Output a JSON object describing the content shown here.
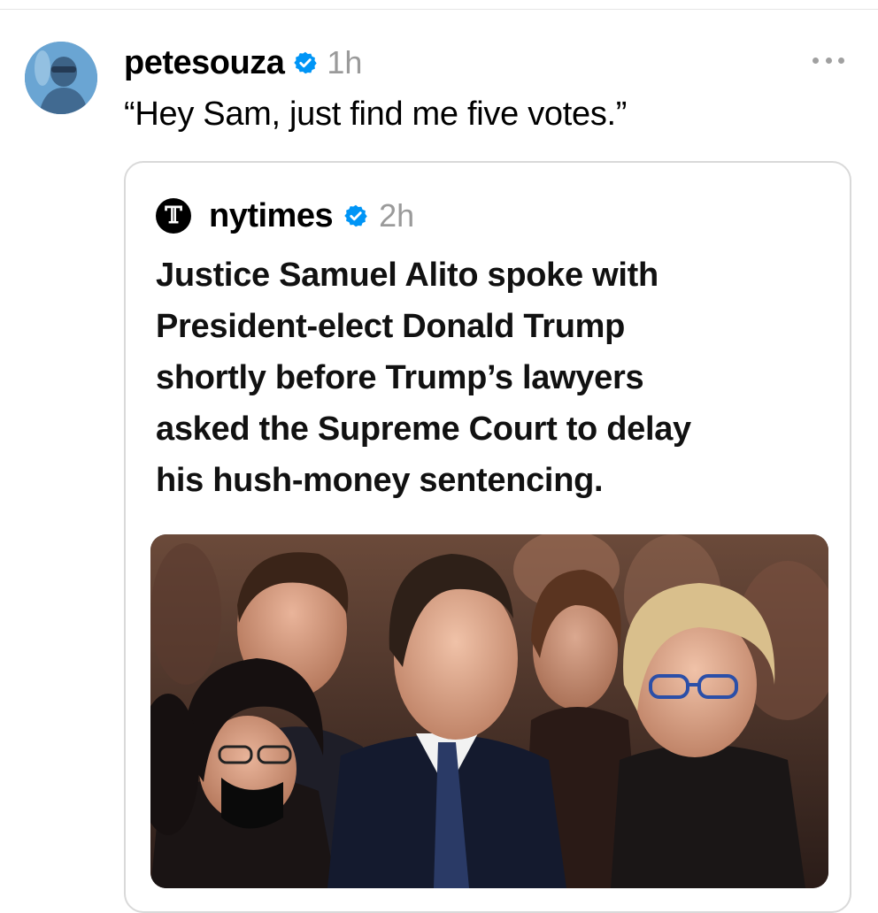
{
  "post": {
    "username": "petesouza",
    "time": "1h",
    "caption": "“Hey Sam, just find me five votes.”",
    "avatar_icon": "profile-photo-avatar",
    "verified_icon": "verified-badge-icon",
    "more_icon": "more-options-icon"
  },
  "quoted": {
    "username": "nytimes",
    "time": "2h",
    "logo_glyph": "𝕋",
    "logo_icon": "nyt-logo-icon",
    "text_lines": [
      "Justice Samuel Alito spoke with",
      "President-elect Donald Trump",
      "shortly before Trump’s lawyers",
      "asked the Supreme Court to delay",
      "his hush-money sentencing."
    ],
    "photo": "news-photo"
  },
  "colors": {
    "verified": "#0095f6",
    "muted": "#9a9a9a",
    "border": "#d9d9d9"
  }
}
